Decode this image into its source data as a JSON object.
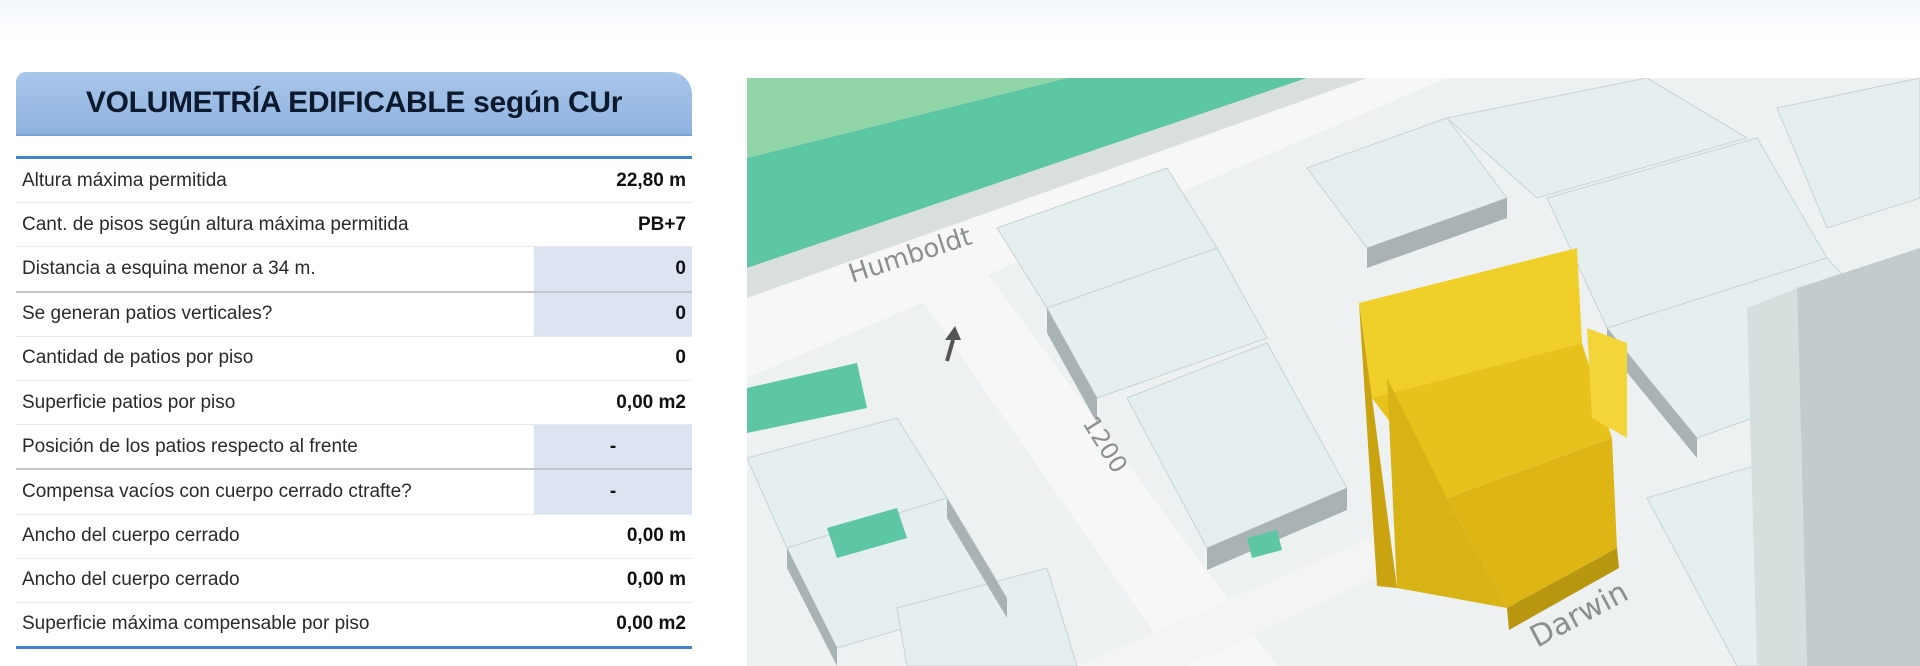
{
  "panel": {
    "title": "VOLUMETRÍA EDIFICABLE según CUr",
    "rows": [
      {
        "label": "Altura máxima permitida",
        "value": "22,80 m",
        "shaded": false
      },
      {
        "label": "Cant. de pisos según altura máxima permitida",
        "value": "PB+7",
        "shaded": false
      },
      {
        "label": "Distancia a esquina menor a 34 m.",
        "value": "0",
        "shaded": true
      },
      {
        "label": "Se generan patios verticales?",
        "value": "0",
        "shaded": true
      },
      {
        "label": "Cantidad de patios por piso",
        "value": "0",
        "shaded": false
      },
      {
        "label": "Superficie patios por piso",
        "value": "0,00 m2",
        "shaded": false
      },
      {
        "label": "Posición de los patios respecto al frente",
        "value": "-",
        "shaded": true
      },
      {
        "label": "Compensa vacíos con cuerpo cerrado ctrafte?",
        "value": "-",
        "shaded": true
      },
      {
        "label": "Ancho del  cuerpo cerrado",
        "value": "0,00 m",
        "shaded": false
      },
      {
        "label": "Ancho del  cuerpo cerrado",
        "value": "0,00 m",
        "shaded": false
      },
      {
        "label": "Superficie máxima compensable por piso",
        "value": "0,00 m2",
        "shaded": false
      }
    ]
  },
  "map": {
    "street_labels": [
      "Humboldt",
      "1200",
      "Darwin"
    ],
    "colors": {
      "building_highlight": "#e8c21c",
      "green_area": "#5dc6a4",
      "buildings": "#e9f1f1",
      "street": "#f7f7f7"
    }
  }
}
